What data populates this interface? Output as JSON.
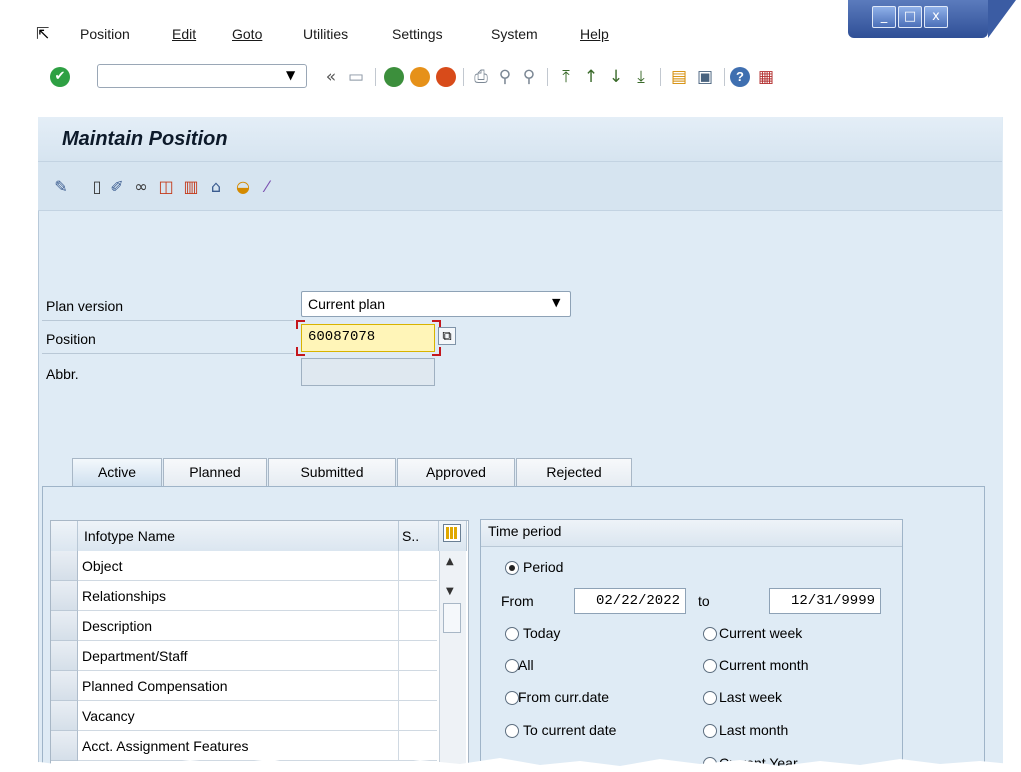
{
  "menu": {
    "items": [
      "Position",
      "Edit",
      "Goto",
      "Utilities",
      "Settings",
      "System",
      "Help"
    ],
    "underlines": [
      "",
      "E",
      "G",
      "s",
      "t",
      "",
      "H"
    ],
    "window_controls": [
      "_",
      "□",
      "x"
    ]
  },
  "toolbar": {
    "command_field_value": "",
    "icons": [
      "check-icon",
      "back-double-chevron-icon",
      "save-icon",
      "back-icon",
      "exit-icon",
      "cancel-icon",
      "print-icon",
      "find-icon",
      "find-next-icon",
      "first-page-icon",
      "previous-page-icon",
      "next-page-icon",
      "last-page-icon",
      "new-session-icon",
      "shortcut-icon",
      "help-icon",
      "customize-layout-icon"
    ]
  },
  "page": {
    "title": "Maintain Position",
    "app_icons": [
      "pencil-glasses-icon",
      "create-icon",
      "change-icon",
      "display-icon",
      "copy-icon",
      "delimit-icon",
      "delete-icon",
      "overview-icon",
      "magic-wand-icon"
    ]
  },
  "form": {
    "plan_version_label": "Plan version",
    "plan_version_value": "Current plan",
    "position_label": "Position",
    "position_value": "60087078",
    "abbr_label": "Abbr.",
    "abbr_value": ""
  },
  "tabs": [
    {
      "label": "Active",
      "active": true
    },
    {
      "label": "Planned",
      "active": false
    },
    {
      "label": "Submitted",
      "active": false
    },
    {
      "label": "Approved",
      "active": false
    },
    {
      "label": "Rejected",
      "active": false
    }
  ],
  "infotype_table": {
    "headers": [
      "Infotype Name",
      "S.."
    ],
    "rows": [
      "Object",
      "Relationships",
      "Description",
      "Department/Staff",
      "Planned Compensation",
      "Vacancy",
      "Acct. Assignment Features"
    ]
  },
  "time_period": {
    "title": "Time period",
    "period_label": "Period",
    "from_label": "From",
    "from_value": "02/22/2022",
    "to_label": "to",
    "to_value": "12/31/9999",
    "options_left": [
      "Today",
      "All",
      "From curr.date",
      "To current date"
    ],
    "options_right": [
      "Current week",
      "Current month",
      "Last week",
      "Last month",
      "Current Year"
    ],
    "selected": "Period"
  },
  "colors": {
    "screen_bg": "#dfebf5",
    "required_field": "#fff5b8",
    "window_controls": "#3b5ca3"
  }
}
